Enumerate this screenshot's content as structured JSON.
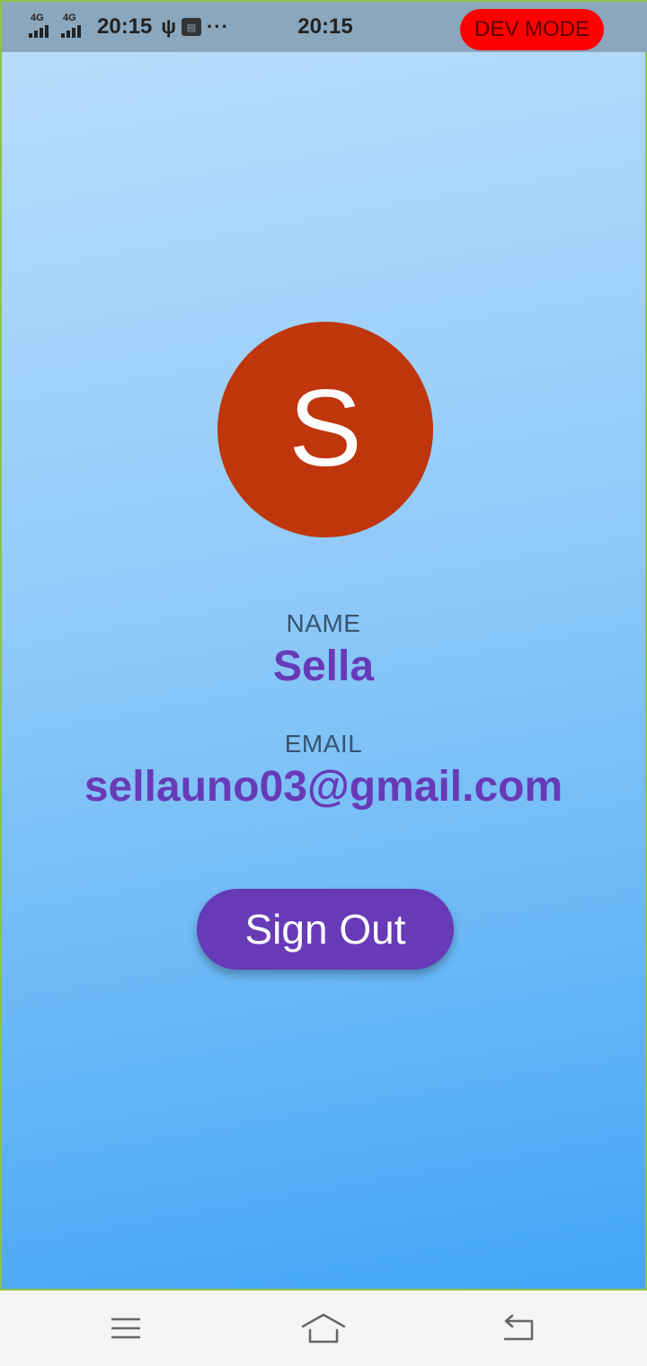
{
  "status_bar": {
    "network_1": "4G",
    "network_2": "4G",
    "time_left": "20:15",
    "time_center": "20:15",
    "more": "···",
    "dev_mode_label": "DEV MODE",
    "dev_mode_color": "#ff0000",
    "icons": [
      "signal-icon",
      "signal-icon",
      "usb-icon",
      "storage-icon",
      "more-icon"
    ]
  },
  "profile": {
    "avatar_initial": "S",
    "avatar_color": "#bf360c",
    "name_label": "NAME",
    "name_value": "Sella",
    "email_label": "EMAIL",
    "email_value": "sellauno03@gmail.com",
    "accent_color": "#673ab7"
  },
  "actions": {
    "sign_out_label": "Sign Out"
  },
  "nav_bar": {
    "icons": [
      "menu-icon",
      "home-icon",
      "back-icon"
    ]
  }
}
